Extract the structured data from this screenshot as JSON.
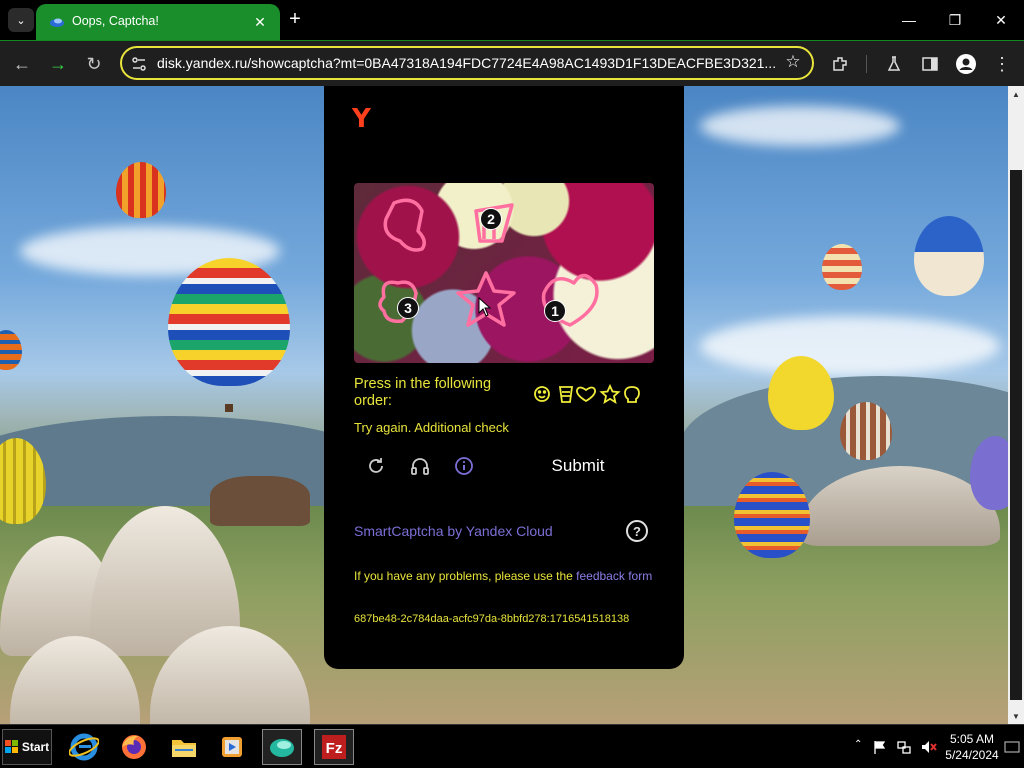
{
  "browser": {
    "tab": {
      "title": "Oops, Captcha!"
    },
    "address_bar": {
      "url": "disk.yandex.ru/showcaptcha?mt=0BA47318A194FDC7724E4A98AC1493D1F13DEACFBE3D321..."
    }
  },
  "captcha": {
    "logo": "Y",
    "marks": [
      "2",
      "3",
      "1"
    ],
    "instruction": "Press in the following order:",
    "order_icons": [
      "smile-icon",
      "cup-icon",
      "heart-icon",
      "star-icon",
      "bulb-icon"
    ],
    "error": "Try again. Additional check",
    "submit_label": "Submit",
    "brand": "SmartCaptcha by Yandex Cloud",
    "help_label": "?",
    "problems_text": "If you have any problems, please use the",
    "feedback_link": "feedback form",
    "request_id": "687be48-2c784daa-acfc97da-8bbfd278:1716541518138",
    "accent_color": "#e8e43c",
    "brand_color": "#7b6fd6"
  },
  "taskbar": {
    "start_label": "Start",
    "apps": [
      "internet-explorer",
      "firefox",
      "file-explorer",
      "media-player",
      "browser",
      "filezilla"
    ],
    "clock_time": "5:05 AM",
    "clock_date": "5/24/2024"
  }
}
